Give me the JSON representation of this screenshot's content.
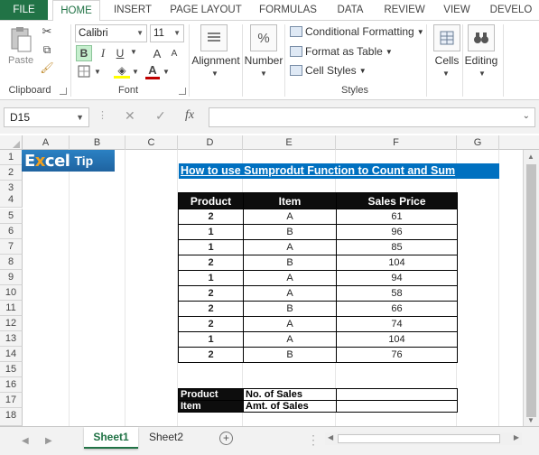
{
  "ribbon_tabs": [
    "FILE",
    "HOME",
    "INSERT",
    "PAGE LAYOUT",
    "FORMULAS",
    "DATA",
    "REVIEW",
    "VIEW",
    "DEVELO"
  ],
  "ribbon": {
    "clipboard": {
      "paste_label": "Paste",
      "group_label": "Clipboard"
    },
    "font": {
      "font_name": "Calibri",
      "font_size": "11",
      "bold": "B",
      "italic": "I",
      "underline": "U",
      "grow": "A",
      "shrink": "A",
      "font_color_letter": "A",
      "group_label": "Font"
    },
    "alignment_label": "Alignment",
    "number": {
      "symbol": "%",
      "label": "Number"
    },
    "styles": {
      "conditional": "Conditional Formatting",
      "as_table": "Format as Table",
      "cell_styles": "Cell Styles",
      "group_label": "Styles"
    },
    "cells_label": "Cells",
    "editing_label": "Editing"
  },
  "formula_bar": {
    "name_box": "D15",
    "cancel": "✕",
    "enter": "✓",
    "fx": "fx",
    "formula": ""
  },
  "columns": [
    "A",
    "B",
    "C",
    "D",
    "E",
    "F",
    "G"
  ],
  "rows": [
    "1",
    "2",
    "3",
    "4",
    "5",
    "6",
    "7",
    "8",
    "9",
    "10",
    "11",
    "12",
    "13",
    "14",
    "15",
    "16",
    "17",
    "18"
  ],
  "logo": {
    "text1a": "E",
    "text1b": "x",
    "text1c": "cel",
    "text2": "Tip"
  },
  "sheet_title": "How to use Sumprodut Function to Count and Sum",
  "table": {
    "headers": [
      "Product",
      "Item",
      "Sales Price"
    ],
    "rows": [
      [
        "2",
        "A",
        "61"
      ],
      [
        "1",
        "B",
        "96"
      ],
      [
        "1",
        "A",
        "85"
      ],
      [
        "2",
        "B",
        "104"
      ],
      [
        "1",
        "A",
        "94"
      ],
      [
        "2",
        "A",
        "58"
      ],
      [
        "2",
        "B",
        "66"
      ],
      [
        "2",
        "A",
        "74"
      ],
      [
        "1",
        "A",
        "104"
      ],
      [
        "2",
        "B",
        "76"
      ]
    ]
  },
  "summary": [
    {
      "key": "Product",
      "label": "No. of Sales",
      "value": ""
    },
    {
      "key": "Item",
      "label": "Amt. of Sales",
      "value": ""
    }
  ],
  "sheet_tabs": [
    "Sheet1",
    "Sheet2"
  ],
  "active_sheet": "Sheet1",
  "accent_color": "#217346",
  "title_fill_color": "#0070c0"
}
